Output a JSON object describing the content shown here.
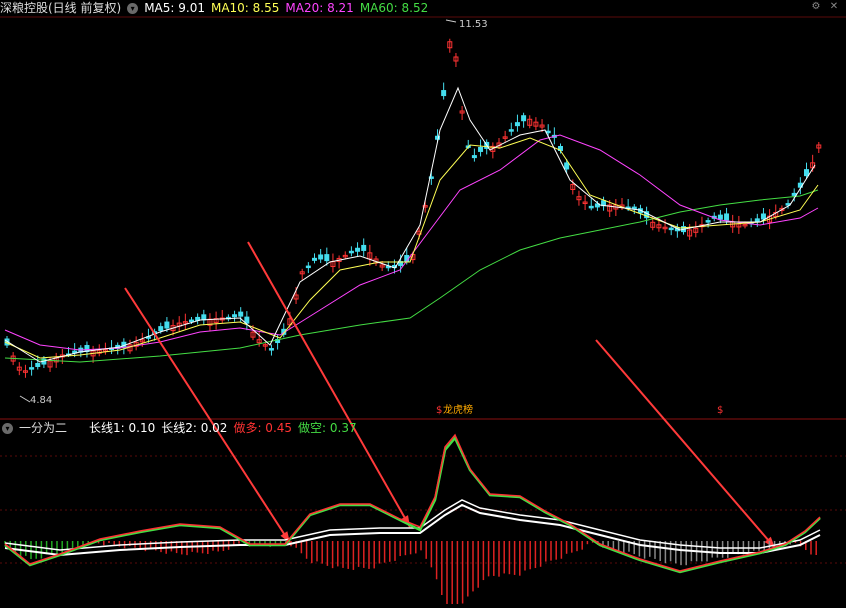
{
  "main": {
    "title": "深粮控股(日线 前复权)",
    "ma5": {
      "label": "MA5: 9.01",
      "color": "#ffffff"
    },
    "ma10": {
      "label": "MA10: 8.55",
      "color": "#ffff55"
    },
    "ma20": {
      "label": "MA20: 8.21",
      "color": "#ff44ff"
    },
    "ma60": {
      "label": "MA60: 8.52",
      "color": "#44dd44"
    },
    "high_label": "11.53",
    "low_label": "4.84",
    "markers": [
      "$",
      "$"
    ],
    "tag": "龙虎榜",
    "up_color": "#ff3333",
    "down_color": "#44ddee"
  },
  "indicator": {
    "name": "一分为二",
    "long1": "长线1: 0.10",
    "long2": "长线2: 0.02",
    "long_short": "做多: 0.45",
    "short": "做空: 0.37",
    "long_color": "#ff3333",
    "short_color": "#44dd44"
  },
  "icons": [
    "chevron-down-icon",
    "gear-icon",
    "close-icon"
  ]
}
